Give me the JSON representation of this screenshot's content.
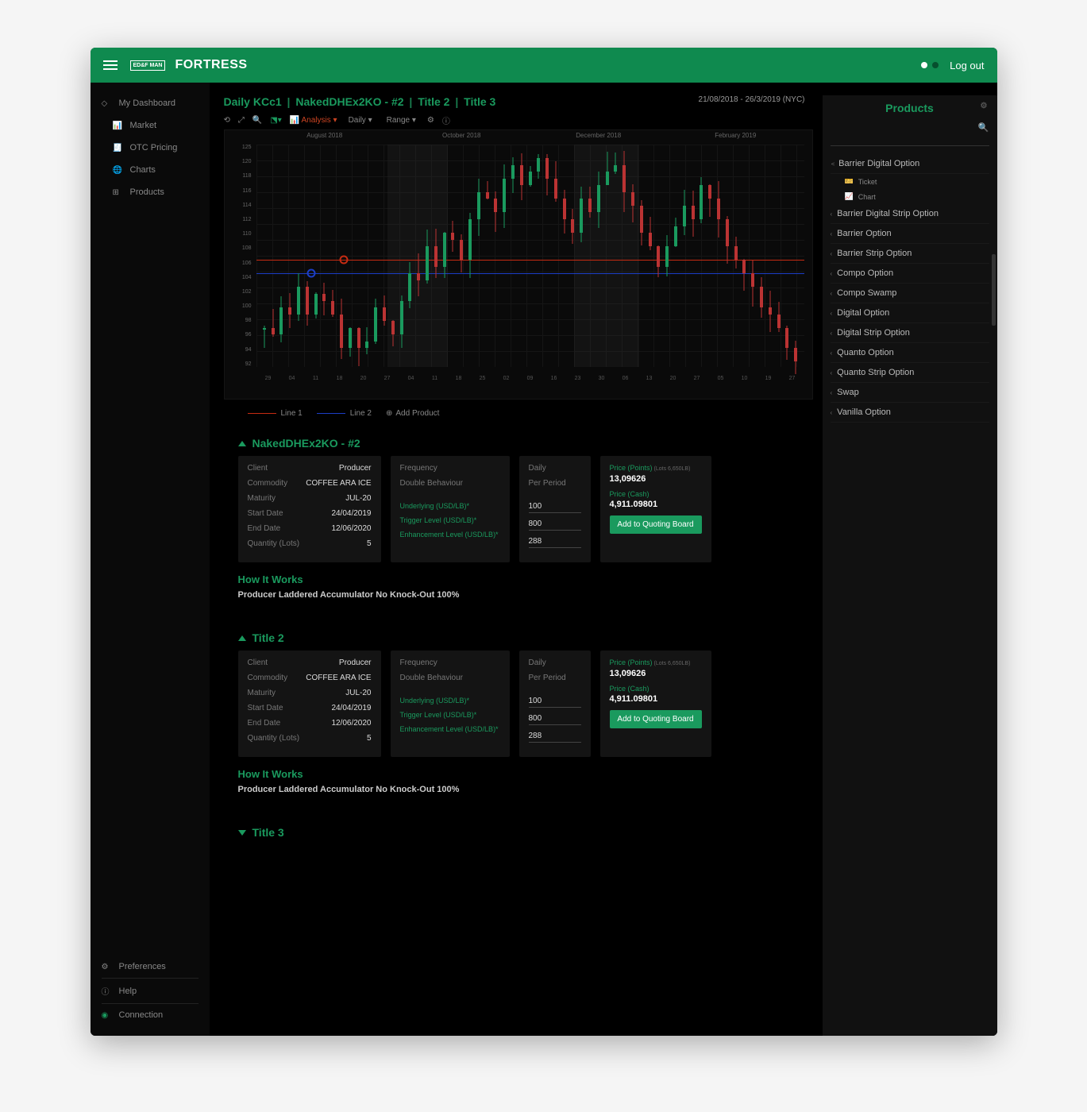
{
  "header": {
    "brand_box": "ED&F\nMAN",
    "brand_title": "FORTRESS",
    "logout": "Log out"
  },
  "sidebar": {
    "dashboard": "My Dashboard",
    "items": [
      {
        "icon": "bars",
        "label": "Market"
      },
      {
        "icon": "doc",
        "label": "OTC Pricing"
      },
      {
        "icon": "globe",
        "label": "Charts"
      },
      {
        "icon": "grid",
        "label": "Products"
      }
    ],
    "prefs": "Preferences",
    "help": "Help",
    "connection": "Connection"
  },
  "breadcrumb": [
    "Daily KCc1",
    "NakedDHEx2KO - #2",
    "Title 2",
    "Title 3"
  ],
  "date_range": "21/08/2018 - 26/3/2019 (NYC)",
  "toolbar": {
    "analysis": "Analysis",
    "daily": "Daily",
    "range": "Range"
  },
  "chart_data": {
    "type": "candlestick",
    "months": [
      "August 2018",
      "October 2018",
      "December 2018",
      "February 2019"
    ],
    "y_ticks": [
      125,
      120,
      118,
      116,
      114,
      112,
      110,
      108,
      106,
      104,
      102,
      100,
      98,
      96,
      94,
      92
    ],
    "x_days": [
      "29",
      "04",
      "11",
      "18",
      "20",
      "27",
      "04",
      "11",
      "18",
      "25",
      "02",
      "09",
      "16",
      "23",
      "30",
      "06",
      "13",
      "20",
      "27",
      "05",
      "10",
      "19",
      "27"
    ],
    "lines": {
      "red_y": 108,
      "blue_y": 106
    },
    "shades": [
      [
        24,
        35
      ],
      [
        58,
        70
      ]
    ]
  },
  "legend": {
    "line1": "Line 1",
    "line2": "Line 2",
    "add": "Add Product"
  },
  "sections": [
    {
      "title": "NakedDHEx2KO - #2",
      "open": true,
      "c1": [
        {
          "k": "Client",
          "v": "Producer"
        },
        {
          "k": "Commodity",
          "v": "COFFEE ARA ICE"
        },
        {
          "k": "Maturity",
          "v": "JUL-20"
        },
        {
          "k": "Start Date",
          "v": "24/04/2019"
        },
        {
          "k": "End Date",
          "v": "12/06/2020"
        },
        {
          "k": "Quantity (Lots)",
          "v": "5"
        }
      ],
      "c2": {
        "freq": "Frequency",
        "behave": "Double Behaviour",
        "under": "Underlying (USD/LB)*",
        "trig": "Trigger Level (USD/LB)*",
        "enh": "Enhancement Level (USD/LB)*"
      },
      "c3": {
        "daily": "Daily",
        "perperiod": "Per Period",
        "v1": "100",
        "v2": "800",
        "v3": "288"
      },
      "c4": {
        "price_points_lbl": "Price (Points)",
        "price_points_sub": "(Lots 6,650LB)",
        "price_points_val": "13,09626",
        "price_cash_lbl": "Price (Cash)",
        "price_cash_val": "4,911.09801",
        "btn": "Add to Quoting Board"
      },
      "how": "How It Works",
      "how_desc": "Producer Laddered Accumulator No Knock-Out 100%"
    },
    {
      "title": "Title 2",
      "open": true,
      "c1": [
        {
          "k": "Client",
          "v": "Producer"
        },
        {
          "k": "Commodity",
          "v": "COFFEE ARA ICE"
        },
        {
          "k": "Maturity",
          "v": "JUL-20"
        },
        {
          "k": "Start Date",
          "v": "24/04/2019"
        },
        {
          "k": "End Date",
          "v": "12/06/2020"
        },
        {
          "k": "Quantity (Lots)",
          "v": "5"
        }
      ],
      "c2": {
        "freq": "Frequency",
        "behave": "Double Behaviour",
        "under": "Underlying (USD/LB)*",
        "trig": "Trigger Level (USD/LB)*",
        "enh": "Enhancement Level (USD/LB)*"
      },
      "c3": {
        "daily": "Daily",
        "perperiod": "Per Period",
        "v1": "100",
        "v2": "800",
        "v3": "288"
      },
      "c4": {
        "price_points_lbl": "Price (Points)",
        "price_points_sub": "(Lots 6,650LB)",
        "price_points_val": "13,09626",
        "price_cash_lbl": "Price (Cash)",
        "price_cash_val": "4,911.09801",
        "btn": "Add to Quoting Board"
      },
      "how": "How It Works",
      "how_desc": "Producer Laddered Accumulator No Knock-Out 100%"
    },
    {
      "title": "Title 3",
      "open": false
    }
  ],
  "products": {
    "title": "Products",
    "items": [
      {
        "label": "Barrier Digital Option",
        "open": true,
        "sub": [
          {
            "icon": "ticket",
            "label": "Ticket"
          },
          {
            "icon": "chart",
            "label": "Chart"
          }
        ]
      },
      {
        "label": "Barrier Digital Strip Option"
      },
      {
        "label": "Barrier Option"
      },
      {
        "label": "Barrier Strip Option"
      },
      {
        "label": "Compo Option"
      },
      {
        "label": "Compo Swamp"
      },
      {
        "label": "Digital Option"
      },
      {
        "label": "Digital Strip Option"
      },
      {
        "label": "Quanto Option"
      },
      {
        "label": "Quanto Strip Option"
      },
      {
        "label": "Swap"
      },
      {
        "label": "Vanilla Option"
      }
    ]
  }
}
